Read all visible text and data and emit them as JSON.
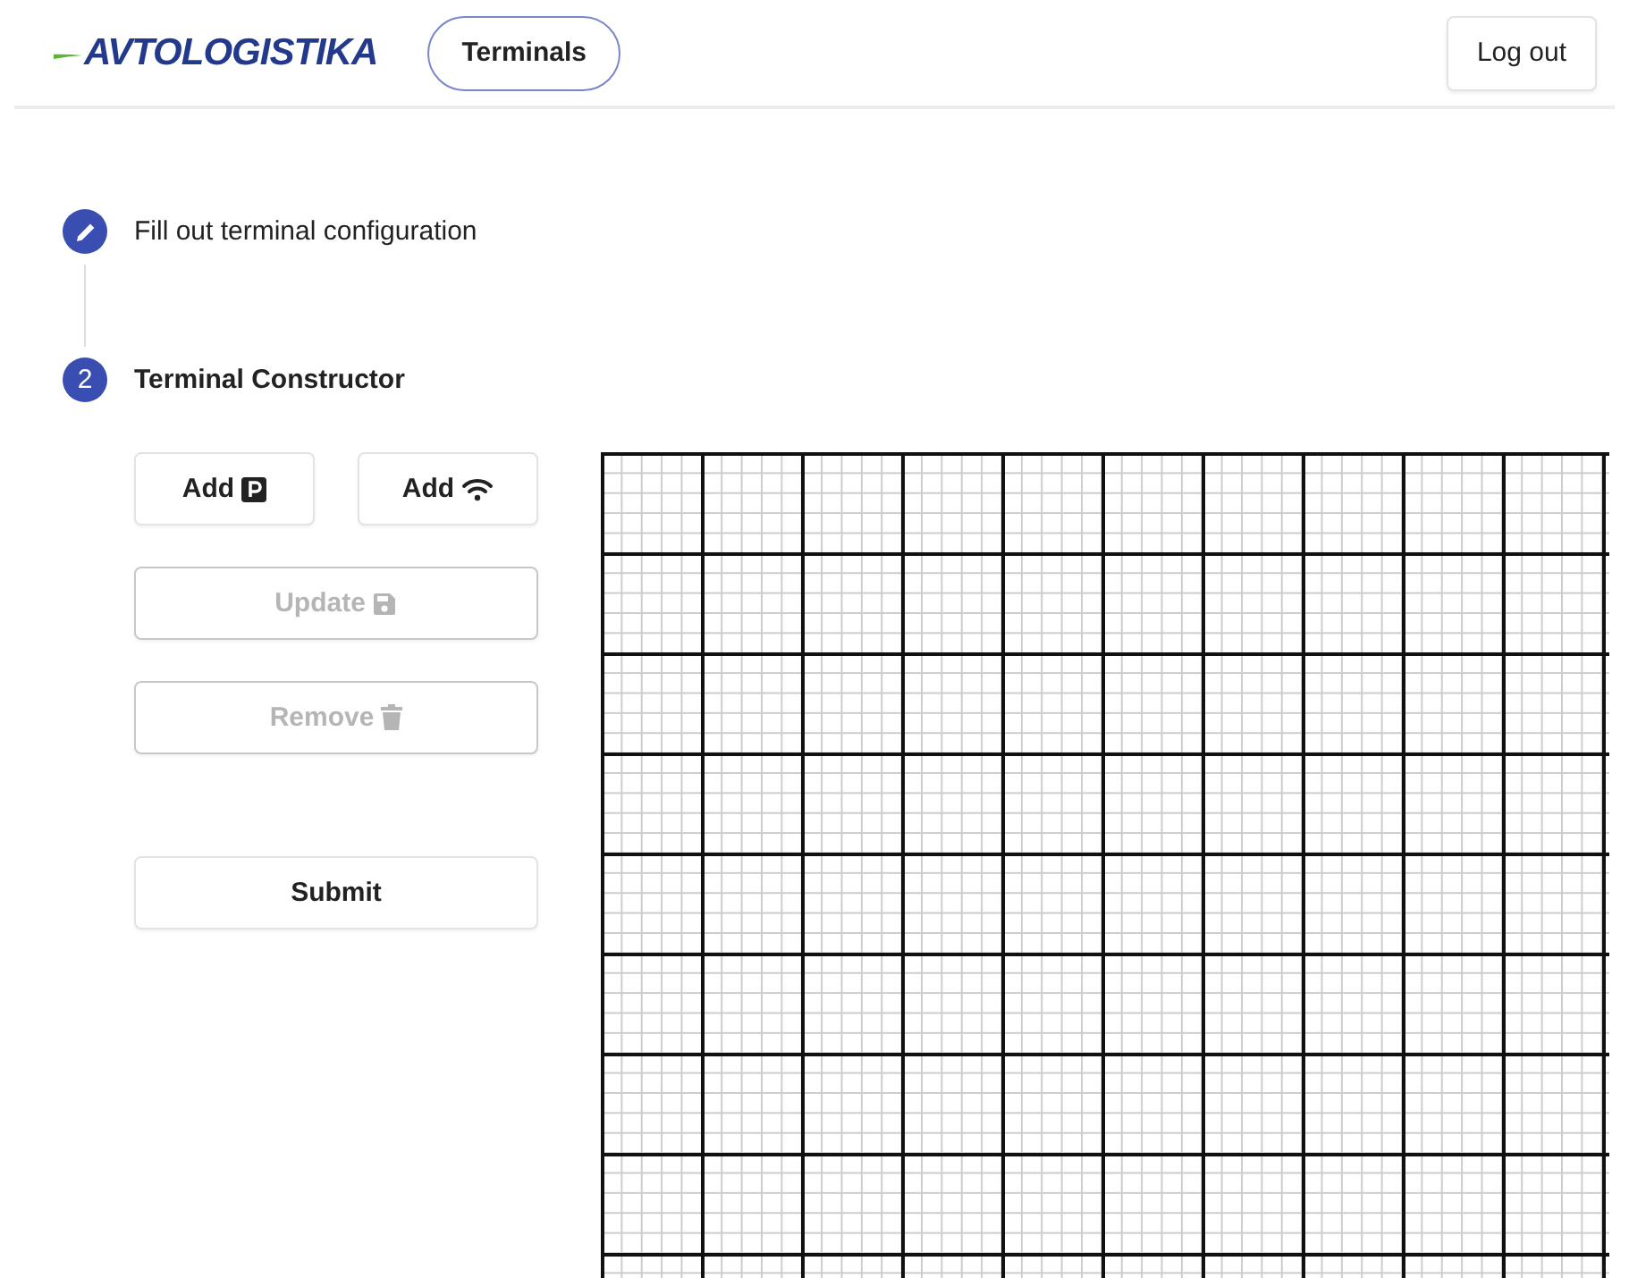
{
  "header": {
    "logo": "AVTOLOGISTIKA",
    "nav": [
      {
        "label": "Terminals",
        "selected": true
      }
    ],
    "logout": "Log out"
  },
  "steps": [
    {
      "kind": "edit",
      "label": "Fill out terminal configuration",
      "active": false
    },
    {
      "kind": "number",
      "number": "2",
      "label": "Terminal Constructor",
      "active": true
    }
  ],
  "tools": [
    {
      "label": "Add",
      "kind": "parking",
      "disabled": false
    },
    {
      "label": "Add",
      "kind": "wifi",
      "disabled": false
    },
    {
      "label": "Update",
      "kind": "save",
      "disabled": true
    },
    {
      "label": "Remove",
      "kind": "trash",
      "disabled": true
    }
  ],
  "submit": {
    "label": "Submit",
    "disabled": false
  }
}
